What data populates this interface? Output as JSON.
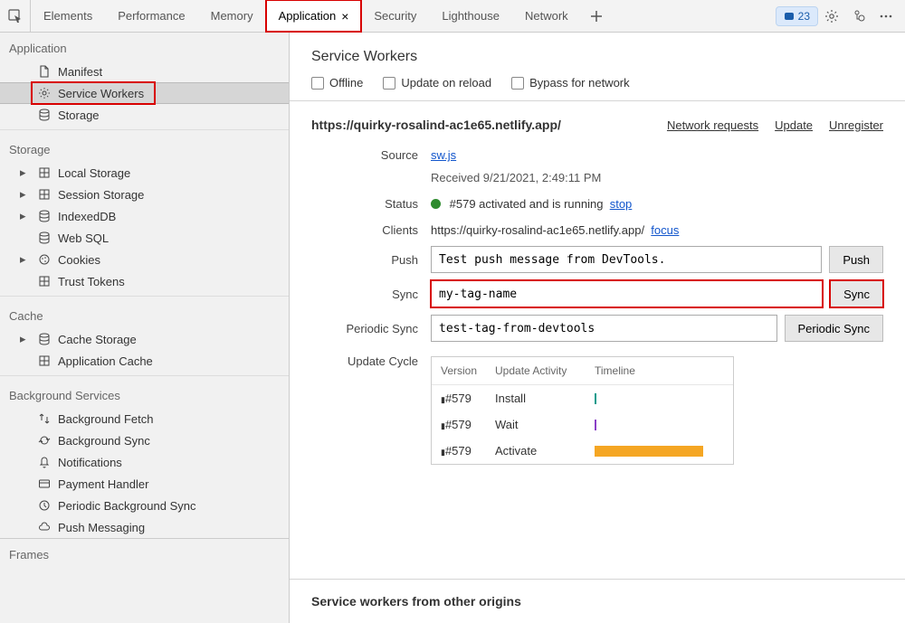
{
  "tabs": [
    "Elements",
    "Performance",
    "Memory",
    "Application",
    "Security",
    "Lighthouse",
    "Network"
  ],
  "active_tab": "Application",
  "issues_count": "23",
  "sidebar": {
    "app_title": "Application",
    "app_items": [
      {
        "label": "Manifest",
        "icon": "file"
      },
      {
        "label": "Service Workers",
        "icon": "gear",
        "selected": true
      },
      {
        "label": "Storage",
        "icon": "db"
      }
    ],
    "storage_title": "Storage",
    "storage_items": [
      {
        "label": "Local Storage",
        "icon": "grid",
        "expandable": true
      },
      {
        "label": "Session Storage",
        "icon": "grid",
        "expandable": true
      },
      {
        "label": "IndexedDB",
        "icon": "db",
        "expandable": true
      },
      {
        "label": "Web SQL",
        "icon": "db"
      },
      {
        "label": "Cookies",
        "icon": "cookie",
        "expandable": true
      },
      {
        "label": "Trust Tokens",
        "icon": "grid"
      }
    ],
    "cache_title": "Cache",
    "cache_items": [
      {
        "label": "Cache Storage",
        "icon": "db",
        "expandable": true
      },
      {
        "label": "Application Cache",
        "icon": "grid"
      }
    ],
    "bg_title": "Background Services",
    "bg_items": [
      {
        "label": "Background Fetch",
        "icon": "fetch"
      },
      {
        "label": "Background Sync",
        "icon": "sync"
      },
      {
        "label": "Notifications",
        "icon": "bell"
      },
      {
        "label": "Payment Handler",
        "icon": "card"
      },
      {
        "label": "Periodic Background Sync",
        "icon": "clock"
      },
      {
        "label": "Push Messaging",
        "icon": "cloud"
      }
    ],
    "frames_title": "Frames"
  },
  "header": {
    "title": "Service Workers",
    "checks": [
      "Offline",
      "Update on reload",
      "Bypass for network"
    ]
  },
  "sw": {
    "origin": "https://quirky-rosalind-ac1e65.netlify.app/",
    "actions": [
      "Network requests",
      "Update",
      "Unregister"
    ],
    "source_label": "Source",
    "source_link": "sw.js",
    "received": "Received 9/21/2021, 2:49:11 PM",
    "status_label": "Status",
    "status_text": "#579 activated and is running",
    "status_action": "stop",
    "clients_label": "Clients",
    "clients_url": "https://quirky-rosalind-ac1e65.netlify.app/",
    "clients_action": "focus",
    "push_label": "Push",
    "push_value": "Test push message from DevTools.",
    "push_btn": "Push",
    "sync_label": "Sync",
    "sync_value": "my-tag-name",
    "sync_btn": "Sync",
    "psync_label": "Periodic Sync",
    "psync_value": "test-tag-from-devtools",
    "psync_btn": "Periodic Sync",
    "cycle_label": "Update Cycle",
    "cycle_headers": [
      "Version",
      "Update Activity",
      "Timeline"
    ],
    "cycle_rows": [
      {
        "v": "#579",
        "a": "Install",
        "t": "tick-green"
      },
      {
        "v": "#579",
        "a": "Wait",
        "t": "tick-purple"
      },
      {
        "v": "#579",
        "a": "Activate",
        "t": "bar-orange"
      }
    ]
  },
  "footer": "Service workers from other origins"
}
